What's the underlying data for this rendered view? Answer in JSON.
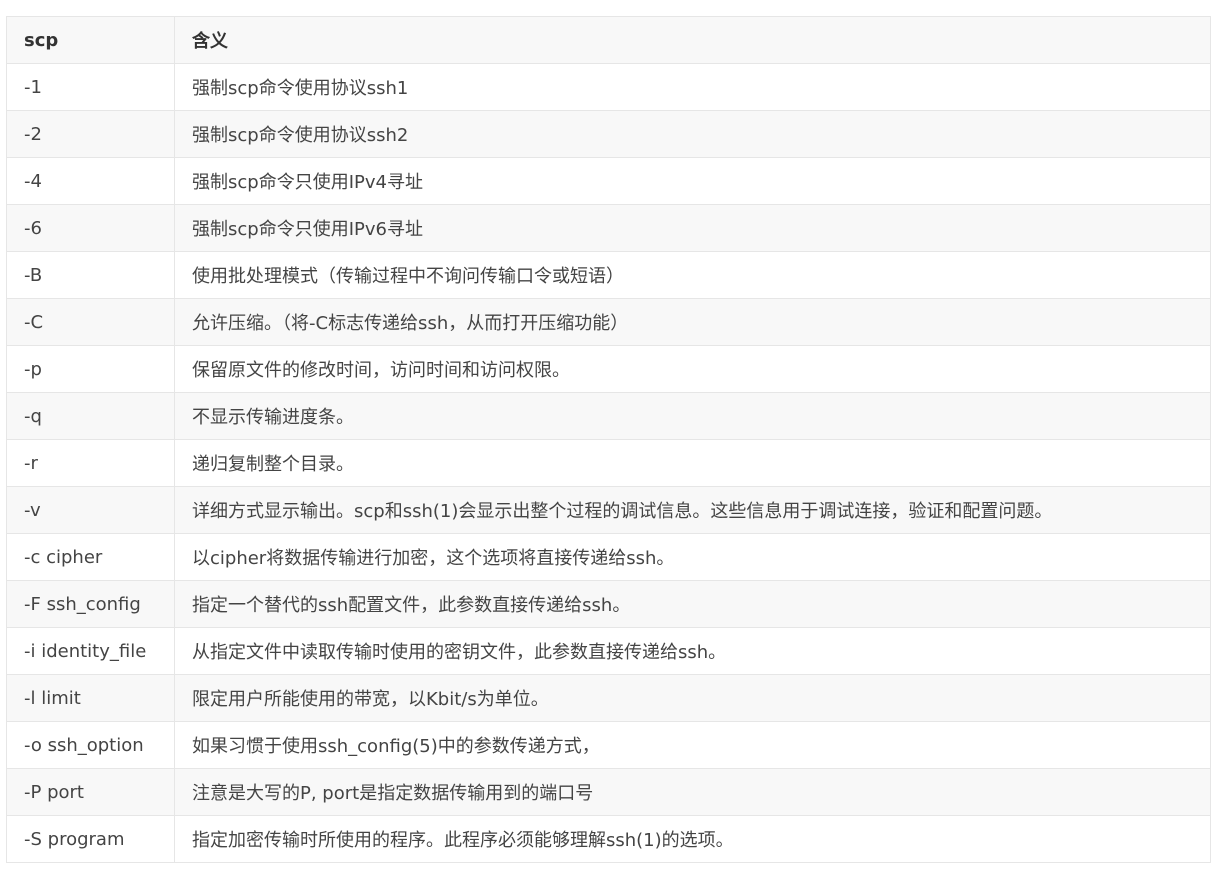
{
  "table": {
    "headers": [
      "scp",
      "含义"
    ],
    "rows": [
      [
        "-1",
        "强制scp命令使用协议ssh1"
      ],
      [
        "-2",
        "强制scp命令使用协议ssh2"
      ],
      [
        "-4",
        "强制scp命令只使用IPv4寻址"
      ],
      [
        "-6",
        "强制scp命令只使用IPv6寻址"
      ],
      [
        "-B",
        "使用批处理模式（传输过程中不询问传输口令或短语）"
      ],
      [
        "-C",
        "允许压缩。（将-C标志传递给ssh，从而打开压缩功能）"
      ],
      [
        "-p",
        "保留原文件的修改时间，访问时间和访问权限。"
      ],
      [
        "-q",
        "不显示传输进度条。"
      ],
      [
        "-r",
        "递归复制整个目录。"
      ],
      [
        "-v",
        "详细方式显示输出。scp和ssh(1)会显示出整个过程的调试信息。这些信息用于调试连接，验证和配置问题。"
      ],
      [
        "-c cipher",
        "以cipher将数据传输进行加密，这个选项将直接传递给ssh。"
      ],
      [
        "-F ssh_config",
        "指定一个替代的ssh配置文件，此参数直接传递给ssh。"
      ],
      [
        "-i identity_file",
        "从指定文件中读取传输时使用的密钥文件，此参数直接传递给ssh。"
      ],
      [
        "-l limit",
        "限定用户所能使用的带宽，以Kbit/s为单位。"
      ],
      [
        "-o ssh_option",
        "如果习惯于使用ssh_config(5)中的参数传递方式，"
      ],
      [
        "-P port",
        "注意是大写的P, port是指定数据传输用到的端口号"
      ],
      [
        "-S program",
        "指定加密传输时所使用的程序。此程序必须能够理解ssh(1)的选项。"
      ]
    ]
  }
}
